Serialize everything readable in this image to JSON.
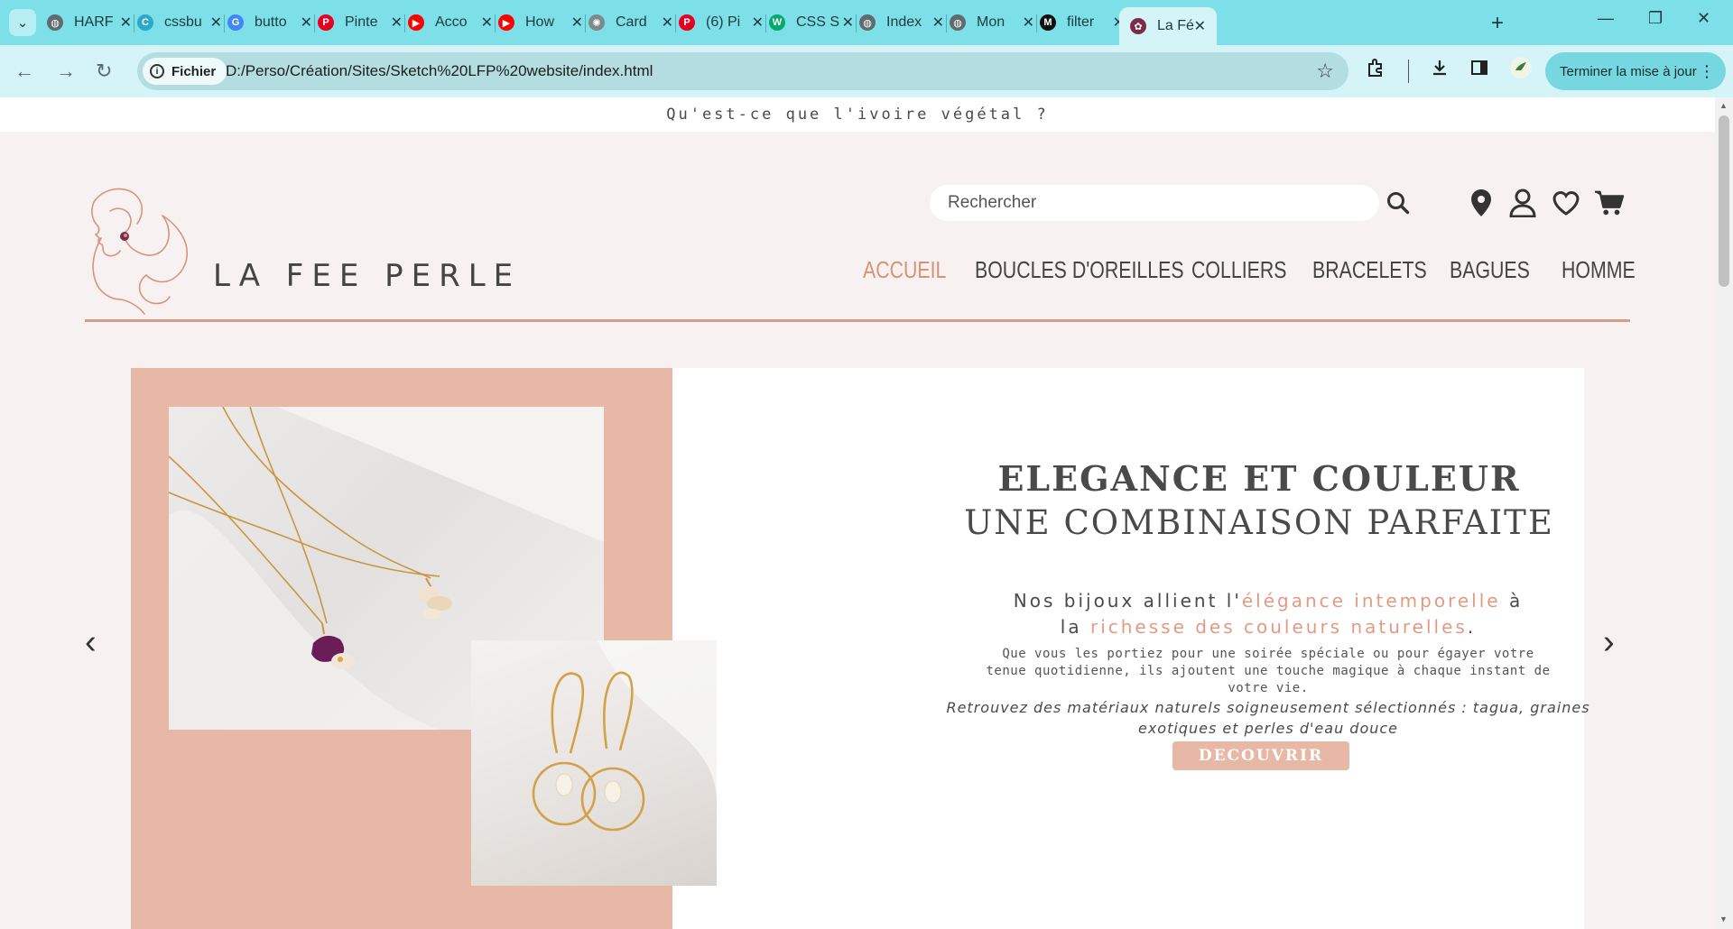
{
  "browser": {
    "tabs": [
      {
        "title": "HARF",
        "favicon": "globe-icon",
        "color": "#5f6b6e"
      },
      {
        "title": "cssbu",
        "favicon": "c-icon",
        "color": "#2da8c8"
      },
      {
        "title": "butto",
        "favicon": "google-icon",
        "color": "#4285f4"
      },
      {
        "title": "Pinte",
        "favicon": "pinterest-icon",
        "color": "#e60023"
      },
      {
        "title": "Acco",
        "favicon": "youtube-icon",
        "color": "#ff0000"
      },
      {
        "title": "How",
        "favicon": "youtube-icon",
        "color": "#ff0000"
      },
      {
        "title": "Card",
        "favicon": "chatgpt-icon",
        "color": "#7d8a8c"
      },
      {
        "title": "(6) Pi",
        "favicon": "pinterest-icon",
        "color": "#e60023"
      },
      {
        "title": "CSS S",
        "favicon": "w3-icon",
        "color": "#04aa6d"
      },
      {
        "title": "Index",
        "favicon": "globe-icon",
        "color": "#5f6b6e"
      },
      {
        "title": "Mon",
        "favicon": "globe-icon",
        "color": "#5f6b6e"
      },
      {
        "title": "filter",
        "favicon": "medium-icon",
        "color": "#111111"
      },
      {
        "title": "La Fé",
        "favicon": "lafee-icon",
        "color": "#7a2d4a"
      }
    ],
    "tab_glyphs": [
      "◍",
      "C",
      "G",
      "P",
      "▶",
      "▶",
      "✺",
      "P",
      "W",
      "◍",
      "◍",
      "M",
      "✿"
    ],
    "security_chip": "Fichier",
    "url": "D:/Perso/Création/Sites/Sketch%20LFP%20website/index.html",
    "update_button": "Terminer la mise à jour"
  },
  "page": {
    "promo_banner": "Qu'est-ce que l'ivoire végétal ?",
    "brand": "LA FEE PERLE",
    "search_placeholder": "Rechercher",
    "accent_color": "#d59475",
    "hero_pink": "#e7b8a6",
    "nav": [
      {
        "label": "ACCUEIL",
        "active": true
      },
      {
        "label": "BOUCLES D'OREILLES",
        "active": false
      },
      {
        "label": "COLLIERS",
        "active": false
      },
      {
        "label": "BRACELETS",
        "active": false
      },
      {
        "label": "BAGUES",
        "active": false
      },
      {
        "label": "HOMME",
        "active": false
      }
    ],
    "hero": {
      "title_line1": "ELEGANCE ET COULEUR",
      "title_line2": "UNE COMBINAISON PARFAITE",
      "p1_a": "Nos bijoux allient l'",
      "p1_accent1": "élégance intemporelle",
      "p1_b": " à",
      "p1_c": "la ",
      "p1_accent2": "richesse des couleurs naturelles",
      "p1_d": ".",
      "p2": "Que vous les portiez pour une soirée spéciale ou pour égayer votre tenue quotidienne, ils ajoutent une touche magique à chaque instant de votre vie.",
      "p3": "Retrouvez des matériaux naturels soigneusement sélectionnés : tagua, graines exotiques et perles d'eau douce",
      "cta": "DECOUVRIR",
      "prev_arrow": "‹",
      "next_arrow": "›"
    }
  }
}
